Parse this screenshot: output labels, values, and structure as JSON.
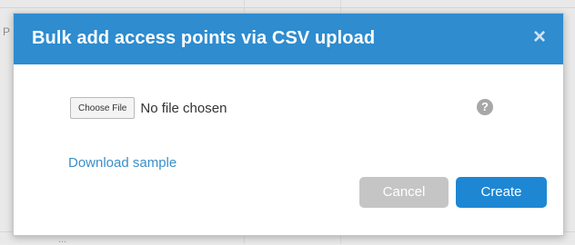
{
  "background": {
    "row_text": "...",
    "edge_letter": "P"
  },
  "modal": {
    "title": "Bulk add access points via CSV upload",
    "close_symbol": "×",
    "file_input": {
      "button_label": "Choose File",
      "status_text": "No file chosen"
    },
    "help_symbol": "?",
    "download_link_text": "Download sample",
    "cancel_label": "Cancel",
    "create_label": "Create"
  },
  "colors": {
    "header_bg": "#2e8ccf",
    "create_bg": "#1d87d3",
    "cancel_bg": "#c5c5c5",
    "link": "#3b8fc9"
  },
  "icons": {
    "close": "close-icon",
    "help": "help-icon"
  }
}
